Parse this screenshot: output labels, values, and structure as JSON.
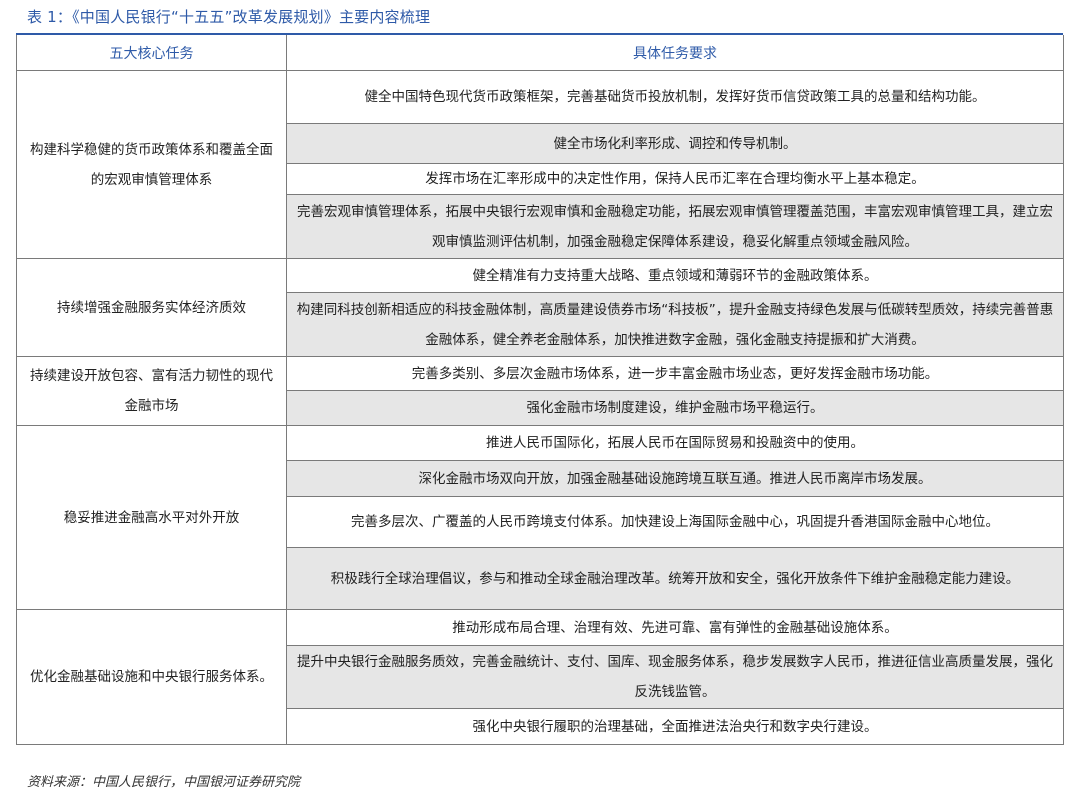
{
  "caption": "表 1：《中国人民银行“十五五”改革发展规划》主要内容梳理",
  "table": {
    "headers": [
      "五大核心任务",
      "具体任务要求"
    ],
    "groups": [
      {
        "task": "构建科学稳健的货币政策体系和覆盖全面的宏观审慎管理体系",
        "requirements": [
          "健全中国特色现代货币政策框架，完善基础货币投放机制，发挥好货币信贷政策工具的总量和结构功能。",
          "健全市场化利率形成、调控和传导机制。",
          "发挥市场在汇率形成中的决定性作用，保持人民币汇率在合理均衡水平上基本稳定。",
          "完善宏观审慎管理体系，拓展中央银行宏观审慎和金融稳定功能，拓展宏观审慎管理覆盖范围，丰富宏观审慎管理工具，建立宏观审慎监测评估机制，加强金融稳定保障体系建设，稳妥化解重点领域金融风险。"
        ]
      },
      {
        "task": "持续增强金融服务实体经济质效",
        "requirements": [
          "健全精准有力支持重大战略、重点领域和薄弱环节的金融政策体系。",
          "构建同科技创新相适应的科技金融体制，高质量建设债券市场“科技板”，提升金融支持绿色发展与低碳转型质效，持续完善普惠金融体系，健全养老金融体系，加快推进数字金融，强化金融支持提振和扩大消费。"
        ]
      },
      {
        "task": "持续建设开放包容、富有活力韧性的现代金融市场",
        "requirements": [
          "完善多类别、多层次金融市场体系，进一步丰富金融市场业态，更好发挥金融市场功能。",
          "强化金融市场制度建设，维护金融市场平稳运行。"
        ]
      },
      {
        "task": "稳妥推进金融高水平对外开放",
        "requirements": [
          "推进人民币国际化，拓展人民币在国际贸易和投融资中的使用。",
          "深化金融市场双向开放，加强金融基础设施跨境互联互通。推进人民币离岸市场发展。",
          "完善多层次、广覆盖的人民币跨境支付体系。加快建设上海国际金融中心，巩固提升香港国际金融中心地位。",
          "积极践行全球治理倡议，参与和推动全球金融治理改革。统筹开放和安全，强化开放条件下维护金融稳定能力建设。"
        ]
      },
      {
        "task": "优化金融基础设施和中央银行服务体系。",
        "requirements": [
          "推动形成布局合理、治理有效、先进可靠、富有弹性的金融基础设施体系。",
          "提升中央银行金融服务质效，完善金融统计、支付、国库、现金服务体系，稳步发展数字人民币，推进征信业高质量发展，强化反洗钱监管。",
          "强化中央银行履职的治理基础，全面推进法治央行和数字央行建设。"
        ]
      }
    ]
  },
  "source": "资料来源：中国人民银行，中国银河证券研究院"
}
